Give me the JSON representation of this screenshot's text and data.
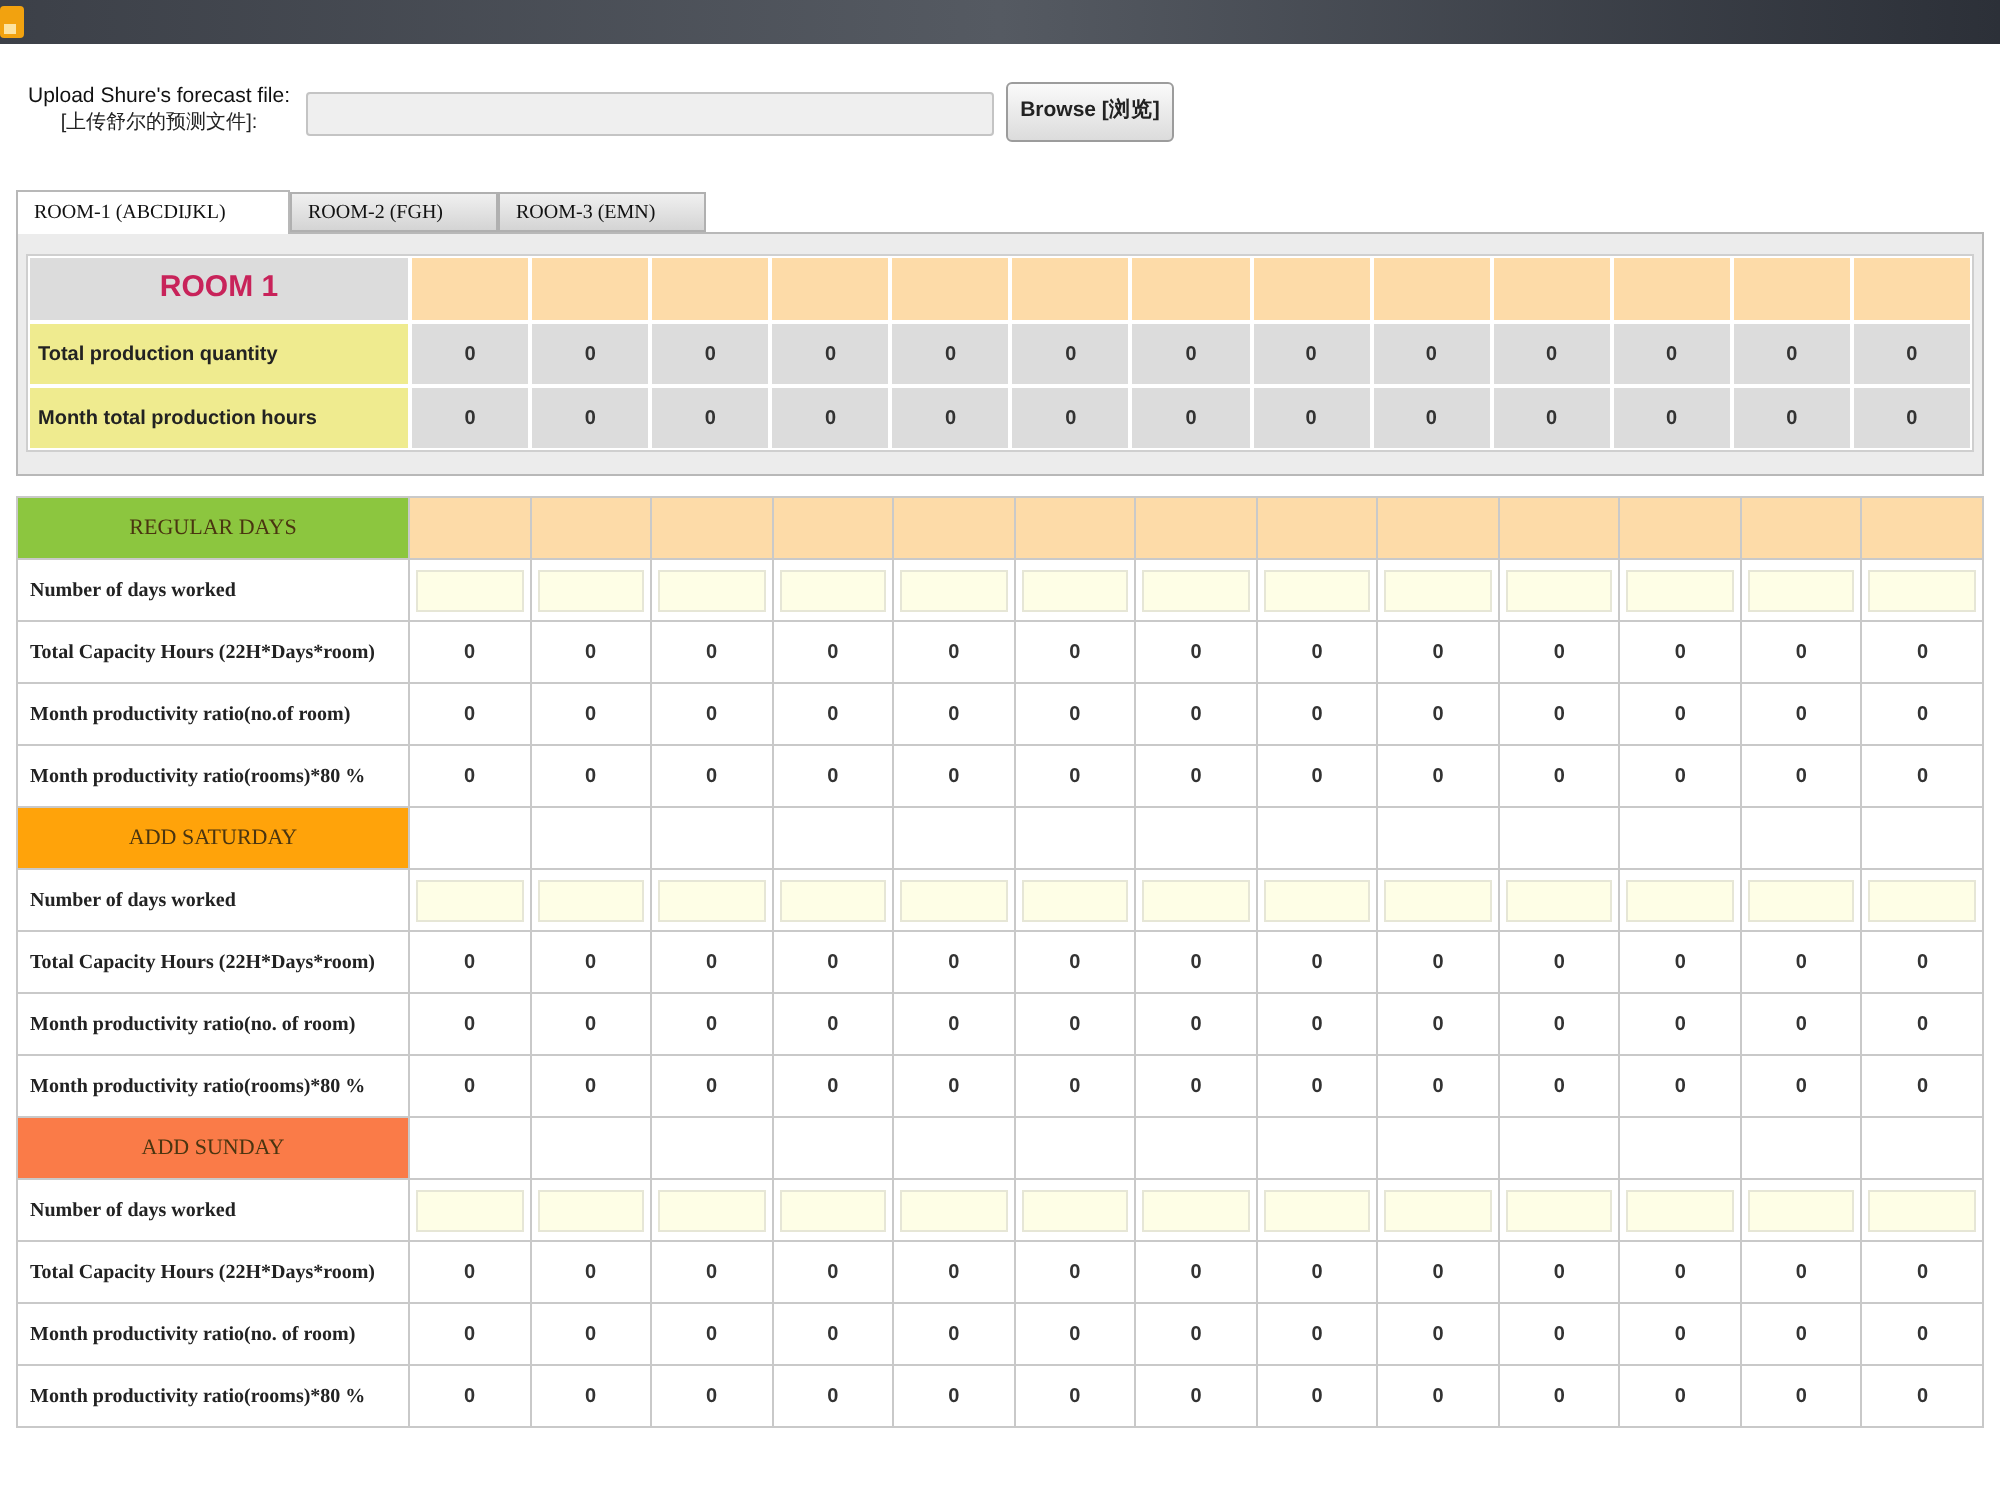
{
  "upload": {
    "label": "Upload Shure's forecast file:",
    "label_translation": "[上传舒尔的预测文件]:",
    "button": "Browse [浏览]"
  },
  "tabs": [
    {
      "label": "ROOM-1 (ABCDIJKL)",
      "selected": true
    },
    {
      "label": "ROOM-2 (FGH)",
      "selected": false
    },
    {
      "label": "ROOM-3 (EMN)",
      "selected": false
    }
  ],
  "room_summary": {
    "title": "ROOM 1",
    "rows": [
      {
        "label": "Total production quantity",
        "values": [
          "0",
          "0",
          "0",
          "0",
          "0",
          "0",
          "0",
          "0",
          "0",
          "0",
          "0",
          "0",
          "0"
        ]
      },
      {
        "label": "Month total production hours",
        "values": [
          "0",
          "0",
          "0",
          "0",
          "0",
          "0",
          "0",
          "0",
          "0",
          "0",
          "0",
          "0",
          "0"
        ]
      }
    ]
  },
  "capacity_table": {
    "sections": [
      {
        "title": "REGULAR DAYS",
        "color": "#8cc63f",
        "header_shaded": true,
        "rows": [
          {
            "kind": "input",
            "label": "Number of days worked"
          },
          {
            "kind": "values",
            "label": "Total Capacity Hours (22H*Days*room)",
            "values": [
              "0",
              "0",
              "0",
              "0",
              "0",
              "0",
              "0",
              "0",
              "0",
              "0",
              "0",
              "0",
              "0"
            ]
          },
          {
            "kind": "values",
            "label": "Month productivity ratio(no.of room)",
            "values": [
              "0",
              "0",
              "0",
              "0",
              "0",
              "0",
              "0",
              "0",
              "0",
              "0",
              "0",
              "0",
              "0"
            ]
          },
          {
            "kind": "values",
            "label": "Month productivity ratio(rooms)*80 %",
            "values": [
              "0",
              "0",
              "0",
              "0",
              "0",
              "0",
              "0",
              "0",
              "0",
              "0",
              "0",
              "0",
              "0"
            ]
          }
        ]
      },
      {
        "title": "ADD SATURDAY",
        "color": "#ffa30a",
        "header_shaded": false,
        "rows": [
          {
            "kind": "input",
            "label": "Number of days worked"
          },
          {
            "kind": "values",
            "label": "Total Capacity Hours (22H*Days*room)",
            "values": [
              "0",
              "0",
              "0",
              "0",
              "0",
              "0",
              "0",
              "0",
              "0",
              "0",
              "0",
              "0",
              "0"
            ]
          },
          {
            "kind": "values",
            "label": "Month productivity ratio(no. of room)",
            "values": [
              "0",
              "0",
              "0",
              "0",
              "0",
              "0",
              "0",
              "0",
              "0",
              "0",
              "0",
              "0",
              "0"
            ]
          },
          {
            "kind": "values",
            "label": "Month productivity ratio(rooms)*80 %",
            "values": [
              "0",
              "0",
              "0",
              "0",
              "0",
              "0",
              "0",
              "0",
              "0",
              "0",
              "0",
              "0",
              "0"
            ]
          }
        ]
      },
      {
        "title": "ADD SUNDAY",
        "color": "#fa7b48",
        "header_shaded": false,
        "rows": [
          {
            "kind": "input",
            "label": "Number of days worked"
          },
          {
            "kind": "values",
            "label": "Total Capacity Hours (22H*Days*room)",
            "values": [
              "0",
              "0",
              "0",
              "0",
              "0",
              "0",
              "0",
              "0",
              "0",
              "0",
              "0",
              "0",
              "0"
            ]
          },
          {
            "kind": "values",
            "label": "Month productivity ratio(no. of room)",
            "values": [
              "0",
              "0",
              "0",
              "0",
              "0",
              "0",
              "0",
              "0",
              "0",
              "0",
              "0",
              "0",
              "0"
            ]
          },
          {
            "kind": "values",
            "label": "Month productivity ratio(rooms)*80 %",
            "values": [
              "0",
              "0",
              "0",
              "0",
              "0",
              "0",
              "0",
              "0",
              "0",
              "0",
              "0",
              "0",
              "0"
            ]
          }
        ]
      }
    ]
  }
}
